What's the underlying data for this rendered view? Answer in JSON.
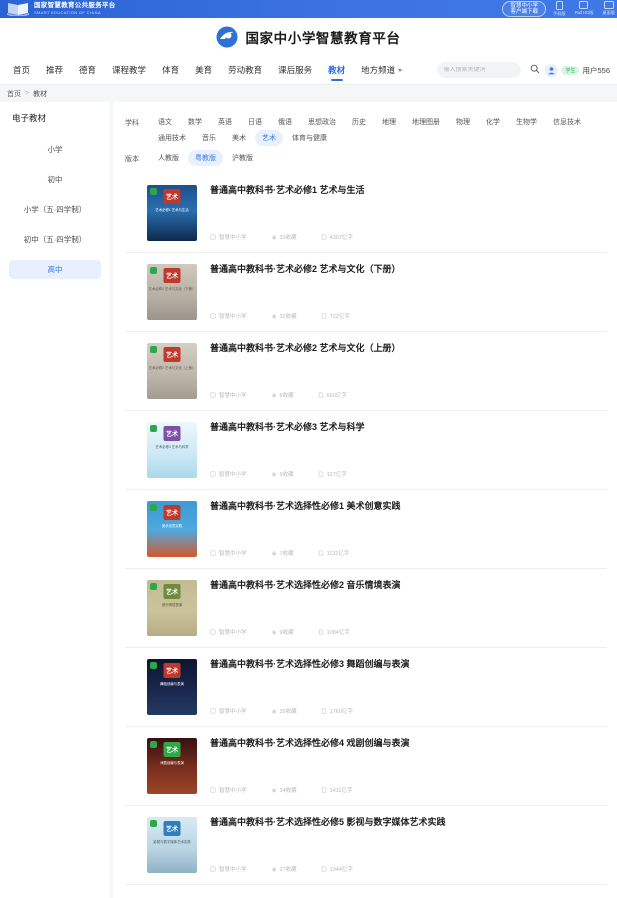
{
  "gov_bar": {
    "logo_cn": "国家智慧教育公共服务平台",
    "logo_en": "SMART EDUCATION OF CHINA",
    "client_button_line1": "智慧中小学",
    "client_button_line2": "客户端下载",
    "downloads": [
      {
        "label": "手机版",
        "icon": "phone-icon"
      },
      {
        "label": "Pad HD版",
        "icon": "tablet-icon"
      },
      {
        "label": "桌面版",
        "icon": "desktop-icon"
      }
    ]
  },
  "header": {
    "title": "国家中小学智慧教育平台",
    "logo_icon": "platform-logo-icon"
  },
  "nav": {
    "items": [
      {
        "label": "首页",
        "active": false
      },
      {
        "label": "推荐",
        "active": false
      },
      {
        "label": "德育",
        "active": false
      },
      {
        "label": "课程教学",
        "active": false
      },
      {
        "label": "体育",
        "active": false
      },
      {
        "label": "美育",
        "active": false
      },
      {
        "label": "劳动教育",
        "active": false
      },
      {
        "label": "课后服务",
        "active": false
      },
      {
        "label": "教材",
        "active": true
      },
      {
        "label": "地方频道",
        "active": false,
        "has_caret": true
      }
    ],
    "search": {
      "placeholder": "输入搜索关键词",
      "value": "",
      "icon": "search-icon"
    },
    "user": {
      "avatar_icon": "user-avatar-icon",
      "role_badge": "学生",
      "name": "用户556"
    }
  },
  "breadcrumb": {
    "items": [
      "首页",
      "教材"
    ],
    "separator": ">"
  },
  "sidebar": {
    "title": "电子教材",
    "items": [
      {
        "label": "小学",
        "active": false
      },
      {
        "label": "初中",
        "active": false
      },
      {
        "label": "小学（五·四学制）",
        "active": false
      },
      {
        "label": "初中（五·四学制）",
        "active": false
      },
      {
        "label": "高中",
        "active": true
      }
    ]
  },
  "filters": [
    {
      "label": "学科",
      "options": [
        {
          "label": "语文",
          "active": false
        },
        {
          "label": "数学",
          "active": false
        },
        {
          "label": "英语",
          "active": false
        },
        {
          "label": "日语",
          "active": false
        },
        {
          "label": "俄语",
          "active": false
        },
        {
          "label": "思想政治",
          "active": false
        },
        {
          "label": "历史",
          "active": false
        },
        {
          "label": "地理",
          "active": false
        },
        {
          "label": "地理图册",
          "active": false
        },
        {
          "label": "物理",
          "active": false
        },
        {
          "label": "化学",
          "active": false
        },
        {
          "label": "生物学",
          "active": false
        },
        {
          "label": "信息技术",
          "active": false
        },
        {
          "label": "通用技术",
          "active": false
        },
        {
          "label": "音乐",
          "active": false
        },
        {
          "label": "美术",
          "active": false
        },
        {
          "label": "艺术",
          "active": true
        },
        {
          "label": "体育与健康",
          "active": false
        }
      ]
    },
    {
      "label": "版本",
      "options": [
        {
          "label": "人教版",
          "active": false
        },
        {
          "label": "粤教版",
          "active": true
        },
        {
          "label": "沪教版",
          "active": false
        }
      ]
    }
  ],
  "books": [
    {
      "title": "普通高中教科书·艺术必修1 艺术与生活",
      "source": "智慧中小学",
      "favorites": "33收藏",
      "size": "4307亿字",
      "cover": {
        "badge": "艺术",
        "subtitle": "艺术必修1 艺术与生活",
        "bg_top": "#1f4e8c",
        "bg_bottom": "#0d2a4d",
        "accent": "#e8a33d"
      }
    },
    {
      "title": "普通高中教科书·艺术必修2 艺术与文化（下册）",
      "source": "智慧中小学",
      "favorites": "32收藏",
      "size": "722亿字",
      "cover": {
        "badge": "艺术",
        "subtitle": "艺术必修2 艺术与文化（下册）",
        "bg_top": "#c9c3ba",
        "bg_bottom": "#9b958c",
        "accent": "#8e8276"
      }
    },
    {
      "title": "普通高中教科书·艺术必修2 艺术与文化（上册）",
      "source": "智慧中小学",
      "favorites": "6收藏",
      "size": "660亿字",
      "cover": {
        "badge": "艺术",
        "subtitle": "艺术必修2 艺术与文化（上册）",
        "bg_top": "#cfc8bd",
        "bg_bottom": "#a49c90",
        "accent": "#8e8276"
      }
    },
    {
      "title": "普通高中教科书·艺术必修3 艺术与科学",
      "source": "智慧中小学",
      "favorites": "9收藏",
      "size": "127亿字",
      "cover": {
        "badge": "艺术",
        "subtitle": "艺术必修3 艺术与科学",
        "bg_top": "#e8f4fb",
        "bg_bottom": "#bfe3f2",
        "accent": "#7e4fa8"
      }
    },
    {
      "title": "普通高中教科书·艺术选择性必修1 美术创意实践",
      "source": "智慧中小学",
      "favorites": "7收藏",
      "size": "1131亿字",
      "cover": {
        "badge": "艺术",
        "subtitle": "美术创意实践",
        "bg_top": "#2d8fd4",
        "bg_bottom": "#d4582a",
        "accent": "#1f6fae"
      }
    },
    {
      "title": "普通高中教科书·艺术选择性必修2 音乐情境表演",
      "source": "智慧中小学",
      "favorites": "9收藏",
      "size": "1084亿字",
      "cover": {
        "badge": "艺术",
        "subtitle": "音乐情境表演",
        "bg_top": "#b7b089",
        "bg_bottom": "#c3ba94",
        "accent": "#6f8a3c"
      }
    },
    {
      "title": "普通高中教科书·艺术选择性必修3 舞蹈创编与表演",
      "source": "智慧中小学",
      "favorites": "25收藏",
      "size": "1760亿字",
      "cover": {
        "badge": "艺术",
        "subtitle": "舞蹈创编与表演",
        "bg_top": "#101a33",
        "bg_bottom": "#1d2b4d",
        "accent": "#2a6bb0"
      }
    },
    {
      "title": "普通高中教科书·艺术选择性必修4 戏剧创编与表演",
      "source": "智慧中小学",
      "favorites": "34收藏",
      "size": "1411亿字",
      "cover": {
        "badge": "艺术",
        "subtitle": "戏剧创编与表演",
        "bg_top": "#3d1014",
        "bg_bottom": "#6e2a1d",
        "accent": "#2fa84a"
      }
    },
    {
      "title": "普通高中教科书·艺术选择性必修5 影视与数字媒体艺术实践",
      "source": "智慧中小学",
      "favorites": "27收藏",
      "size": "1944亿字",
      "cover": {
        "badge": "艺术",
        "subtitle": "影视与数字媒体艺术实践",
        "bg_top": "#cfe6f2",
        "bg_bottom": "#9dbccd",
        "accent": "#2f7fbf"
      }
    }
  ]
}
